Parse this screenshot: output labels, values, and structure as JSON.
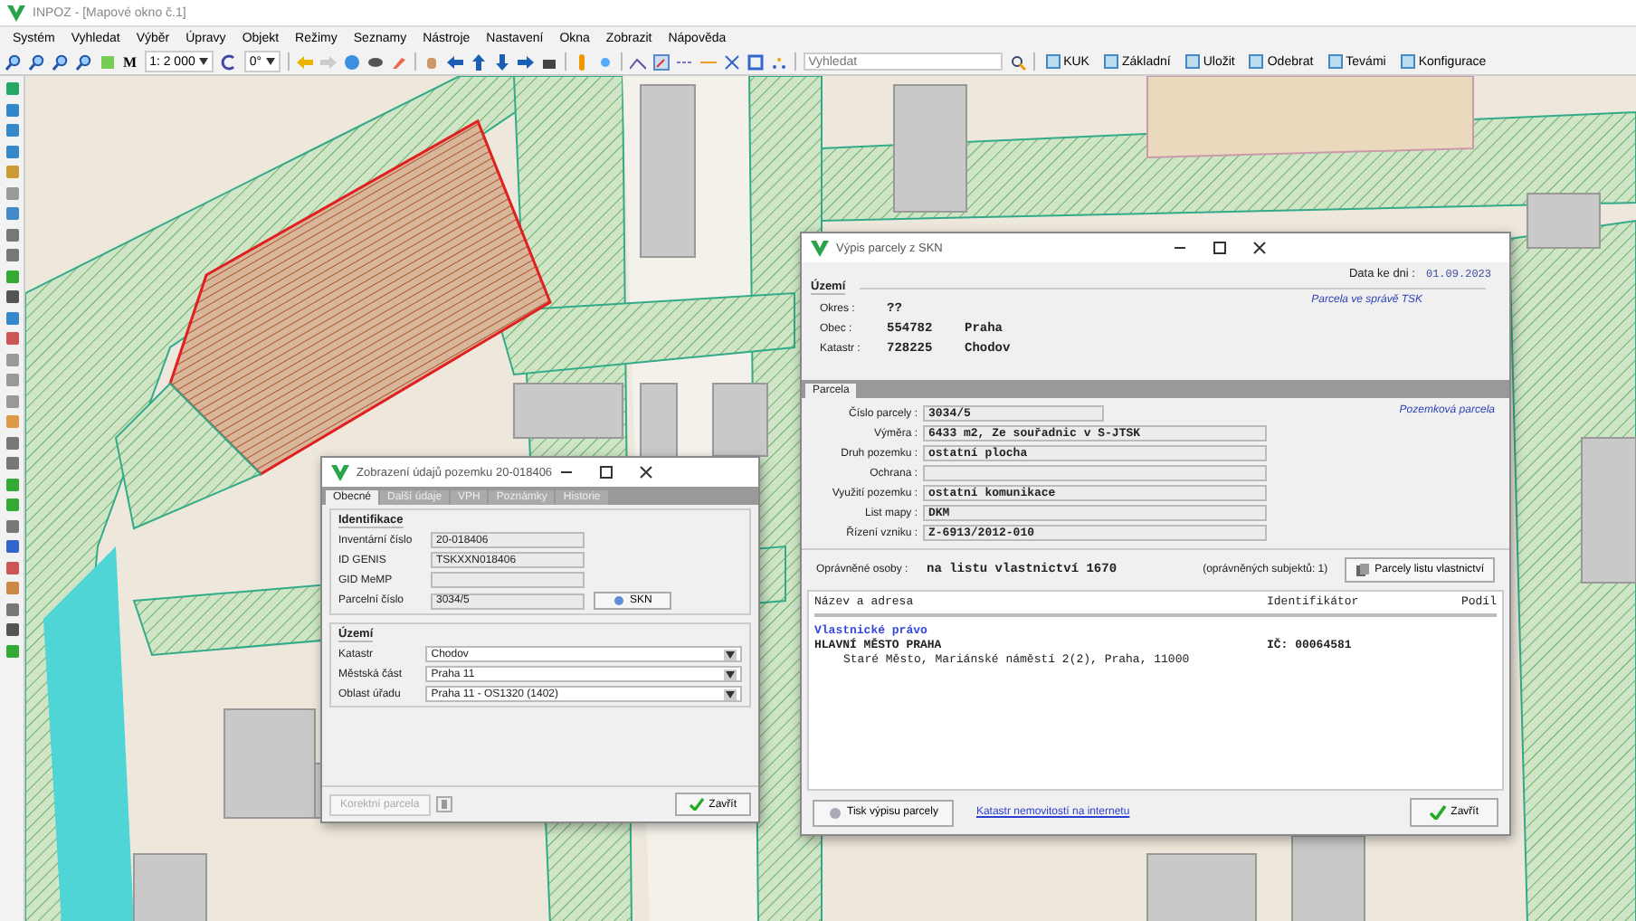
{
  "window": {
    "title": "INPOZ - [Mapové okno č.1]"
  },
  "menu": [
    "Systém",
    "Vyhledat",
    "Výběr",
    "Úpravy",
    "Objekt",
    "Režimy",
    "Seznamy",
    "Nástroje",
    "Nastavení",
    "Okna",
    "Zobrazit",
    "Nápověda"
  ],
  "toolbar": {
    "m_label": "M",
    "scale": "1: 2 000",
    "rotation": "0°",
    "search": {
      "placeholder": "Vyhledat"
    },
    "buttons": [
      "KUK",
      "Základní",
      "Uložit",
      "Odebrat",
      "Tevámi",
      "Konfigurace"
    ]
  },
  "parcel_dialog": {
    "title": "Zobrazení údajů pozemku 20-018406",
    "tabs": [
      {
        "label": "Obecné",
        "selected": true
      },
      {
        "label": "Další údaje",
        "selected": false
      },
      {
        "label": "VPH",
        "selected": false
      },
      {
        "label": "Poznámky",
        "selected": false
      },
      {
        "label": "Historie",
        "selected": false
      }
    ],
    "identification": {
      "title": "Identifikace",
      "fields": [
        {
          "label": "Inventární číslo",
          "value": "20-018406"
        },
        {
          "label": "ID GENIS",
          "value": "TSKXXN018406"
        },
        {
          "label": "GID MeMP"
        },
        {
          "label": "Parcelní číslo",
          "value": "3034/5"
        }
      ],
      "skn_button": "SKN"
    },
    "territory": {
      "title": "Území",
      "fields": [
        {
          "label": "Katastr",
          "value": "Chodov"
        },
        {
          "label": "Městská část",
          "value": "Praha 11"
        },
        {
          "label": "Oblast úřadu",
          "value": "Praha 11 - OS1320 (1402)"
        }
      ]
    },
    "correct_button": {
      "label": "Korektní parcela",
      "disabled": true
    },
    "close_button": "Zavřít"
  },
  "skn_dialog": {
    "title": "Výpis parcely z SKN",
    "date_label": "Data ke dni :",
    "date": "01.09.2023",
    "territory_title": "Území",
    "managed_link": "Parcela ve správě TSK",
    "territory": [
      {
        "label": "Okres :",
        "code": "??"
      },
      {
        "label": "Obec :",
        "code": "554782",
        "name": "Praha"
      },
      {
        "label": "Katastr :",
        "code": "728225",
        "name": "Chodov"
      }
    ],
    "tab": "Parcela",
    "parcel_type_link": "Pozemková parcela",
    "fields": [
      {
        "label": "Číslo parcely :",
        "value": "3034/5"
      },
      {
        "label": "Výměra :",
        "value": "6433 m2, Ze souřadnic v S-JTSK"
      },
      {
        "label": "Druh pozemku :",
        "value": "ostatní plocha"
      },
      {
        "label": "Ochrana :"
      },
      {
        "label": "Využití pozemku :",
        "value": "ostatní komunikace"
      },
      {
        "label": "List mapy :",
        "value": "DKM"
      },
      {
        "label": "Řízení vzniku :",
        "value": "Z-6913/2012-010"
      }
    ],
    "owners_label": "Oprávněné osoby :",
    "owners_value": "na listu vlastnictví 1670",
    "owners_count": "(oprávněných subjektů: 1)",
    "owners_button": "Parcely listu vlastnictví",
    "columns": [
      "Název a adresa",
      "Identifikátor",
      "Podíl"
    ],
    "right_type": "Vlastnické právo",
    "owner_name": "HLAVNÍ MĚSTO PRAHA",
    "owner_id": "IČ: 00064581",
    "owner_address": "Staré Město, Mariánské náměstí 2(2), Praha, 11000",
    "print_button": "Tisk výpisu parcely",
    "cadastre_link": "Katastr nemovitostí na internetu",
    "close_button": "Zavřít"
  }
}
